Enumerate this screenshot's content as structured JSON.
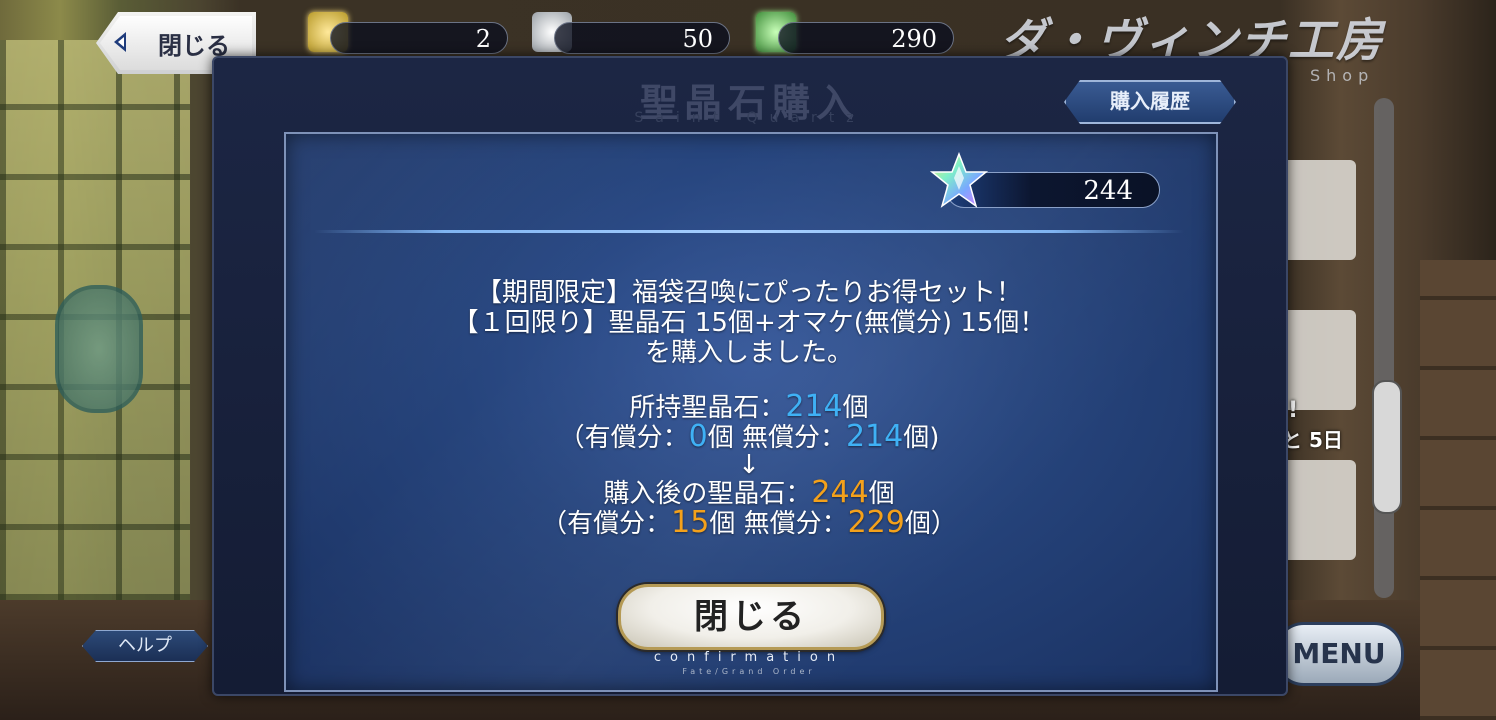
{
  "topbar": {
    "close_label": "閉じる",
    "resources": [
      {
        "icon": "gold-fou-icon",
        "value": "2"
      },
      {
        "icon": "silver-fou-icon",
        "value": "50"
      },
      {
        "icon": "green-fou-icon",
        "value": "290"
      }
    ],
    "shop_title": "ダ・ヴィンチ工房",
    "shop_subtitle": "Shop"
  },
  "modal": {
    "title": "聖晶石購入",
    "title_en": "Saint Quartz",
    "history_label": "購入履歴",
    "quartz_count": "244",
    "message_lines": [
      "【期間限定】福袋召喚にぴったりお得セット！",
      "【１回限り】聖晶石 15個+オマケ(無償分) 15個！",
      "を購入しました。"
    ],
    "before": {
      "label": "所持聖晶石：",
      "total": "214",
      "unit": "個",
      "paid_label": "（有償分：",
      "paid": "0",
      "free_label": "個 無償分：",
      "free": "214",
      "close": "個)"
    },
    "arrow": "↓",
    "after": {
      "label": "購入後の聖晶石：",
      "total": "244",
      "unit": "個",
      "paid_label": "（有償分：",
      "paid": "15",
      "free_label": "個 無償分：",
      "free": "229",
      "close": "個）"
    },
    "close_label": "閉じる",
    "confirm_caption": "confirmation",
    "fgo_caption": "Fate/Grand Order"
  },
  "side": {
    "help_label": "ヘルプ",
    "menu_label": "MENU",
    "peek_exclaim": "!",
    "peek_days": "と 5日"
  },
  "colors": {
    "paid_free_blue": "#3fb1f5",
    "after_orange": "#f4a11b",
    "panel_blue": "#26447c"
  }
}
